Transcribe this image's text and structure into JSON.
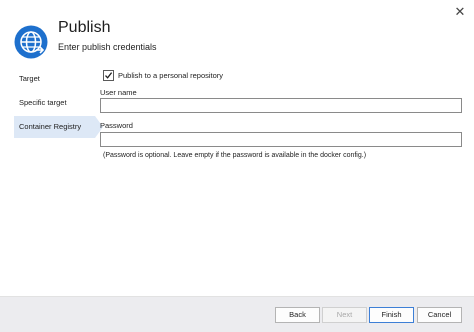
{
  "header": {
    "title": "Publish",
    "subtitle": "Enter publish credentials",
    "icon": "globe-publish-icon",
    "accent_color": "#1e70cd"
  },
  "window": {
    "close_icon": "close-icon"
  },
  "nav": {
    "items": [
      {
        "label": "Target",
        "selected": false
      },
      {
        "label": "Specific target",
        "selected": false
      },
      {
        "label": "Container Registry",
        "selected": true
      }
    ],
    "selected_color": "#dde8f6"
  },
  "form": {
    "publish_checkbox": {
      "label": "Publish to a personal repository",
      "checked": true
    },
    "username": {
      "label": "User name",
      "value": ""
    },
    "password": {
      "label": "Password",
      "value": ""
    },
    "hint": "(Password is optional. Leave empty if the password is available in the docker config.)"
  },
  "footer": {
    "back_label": "Back",
    "next_label": "Next",
    "finish_label": "Finish",
    "cancel_label": "Cancel",
    "next_disabled": true
  }
}
